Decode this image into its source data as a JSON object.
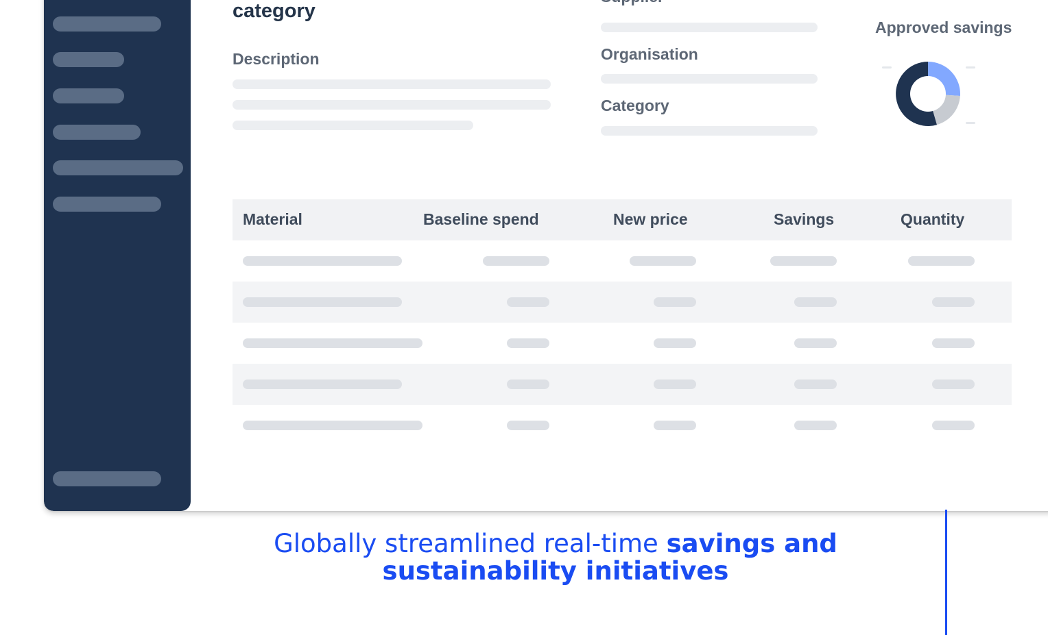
{
  "header": {
    "title": "category",
    "description_label": "Description",
    "supplier_label": "Supplier",
    "organisation_label": "Organisation",
    "category_label": "Category"
  },
  "savings_widget": {
    "title": "Approved savings",
    "colors": {
      "approved": "#82a8ff",
      "pending": "#c7cbd1",
      "other": "#1f3350"
    }
  },
  "table": {
    "columns": [
      "Material",
      "Baseline spend",
      "New price",
      "Savings",
      "Quantity"
    ]
  },
  "caption": {
    "prefix": "Globally streamlined real-time ",
    "emphasis": "savings and sustainability initiatives"
  },
  "colors": {
    "sidebar": "#1f3350",
    "accent": "#1a4cf2"
  }
}
